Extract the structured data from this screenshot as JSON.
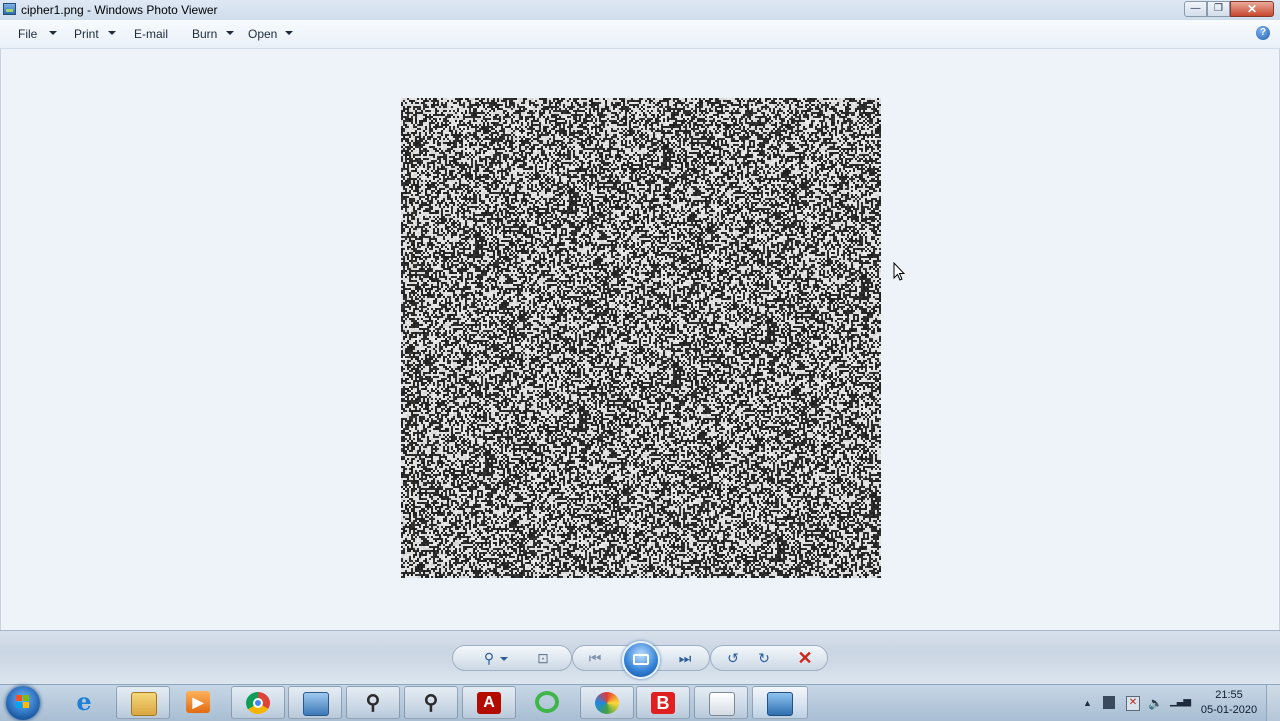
{
  "window": {
    "title": "cipher1.png - Windows Photo Viewer",
    "controls": {
      "minimize": "—",
      "maximize": "❐",
      "close": "✕"
    }
  },
  "menu": {
    "items": [
      {
        "label": "File",
        "has_dropdown": true
      },
      {
        "label": "Print",
        "has_dropdown": true
      },
      {
        "label": "E-mail",
        "has_dropdown": false
      },
      {
        "label": "Burn",
        "has_dropdown": true
      },
      {
        "label": "Open",
        "has_dropdown": true
      }
    ],
    "help_glyph": "?"
  },
  "image": {
    "description_icon": "noise-image",
    "colors": {
      "dark": "#1a1a1a",
      "light": "#f2f2f2"
    }
  },
  "controls": {
    "zoom": "⚲",
    "fit": "⊡",
    "previous": "⏮",
    "next": "⏭",
    "rotate_ccw": "↺",
    "rotate_cw": "↻",
    "delete": "✕"
  },
  "taskbar": {
    "clock_time": "21:55",
    "clock_date": "05-01-2020",
    "apps": [
      "internet-explorer-icon",
      "file-explorer-icon",
      "media-player-icon",
      "chrome-icon",
      "control-panel-icon",
      "search-tool-icon",
      "search-tool-icon",
      "acrobat-icon",
      "green-refresh-icon",
      "colorful-app-icon",
      "bold-b-icon",
      "folder-window-icon",
      "photo-viewer-icon"
    ],
    "tray": {
      "up_arrow": "▲",
      "network": "▮",
      "volume": "🔈",
      "signal": "▁▃▅"
    }
  },
  "colors": {
    "background": "#eef3f9",
    "titlebar": "#dfe9f5",
    "accent_blue": "#2f7fd6",
    "delete_red": "#d0251d"
  }
}
